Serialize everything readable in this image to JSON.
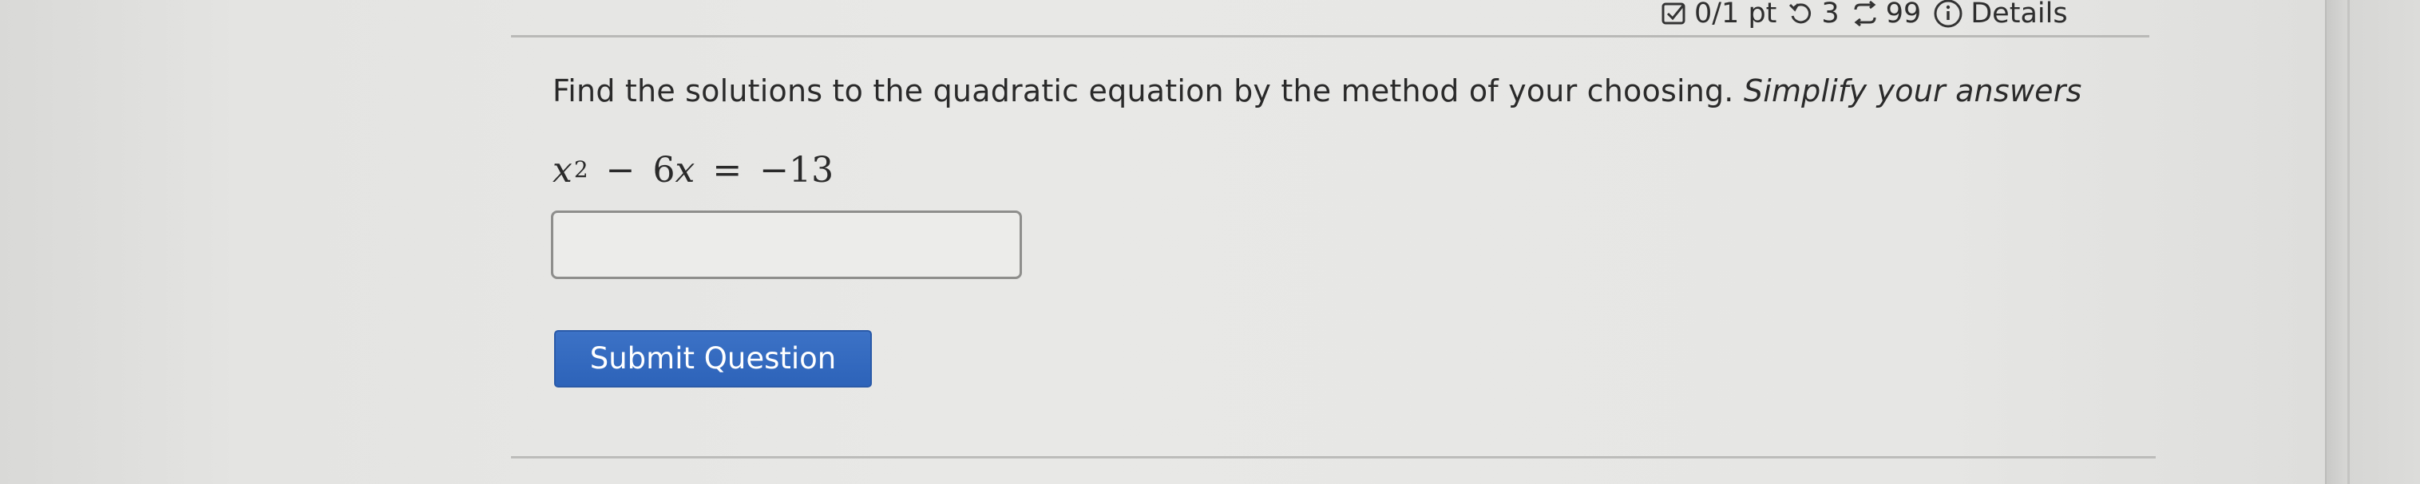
{
  "header": {
    "score": "0/1 pt",
    "retries": "3",
    "attempts": "99",
    "details_label": "Details"
  },
  "question": {
    "prompt": "Find the solutions to the quadratic equation by the method of your choosing.",
    "emphasis": "Simplify your answers",
    "equation": {
      "var": "x",
      "exponent": "2",
      "minus": "−",
      "term": "6",
      "term_var": "x",
      "equals": "=",
      "rhs": "−13"
    }
  },
  "answer": {
    "value": "",
    "placeholder": ""
  },
  "submit": {
    "label": "Submit Question"
  },
  "icons": {
    "score": "checkbox-icon",
    "retries": "retry-icon",
    "attempts": "attempts-icon",
    "details": "info-icon"
  },
  "colors": {
    "submit_bg": "#2d63b9",
    "submit_text": "#ffffff",
    "page_bg": "#e6e6e4"
  }
}
